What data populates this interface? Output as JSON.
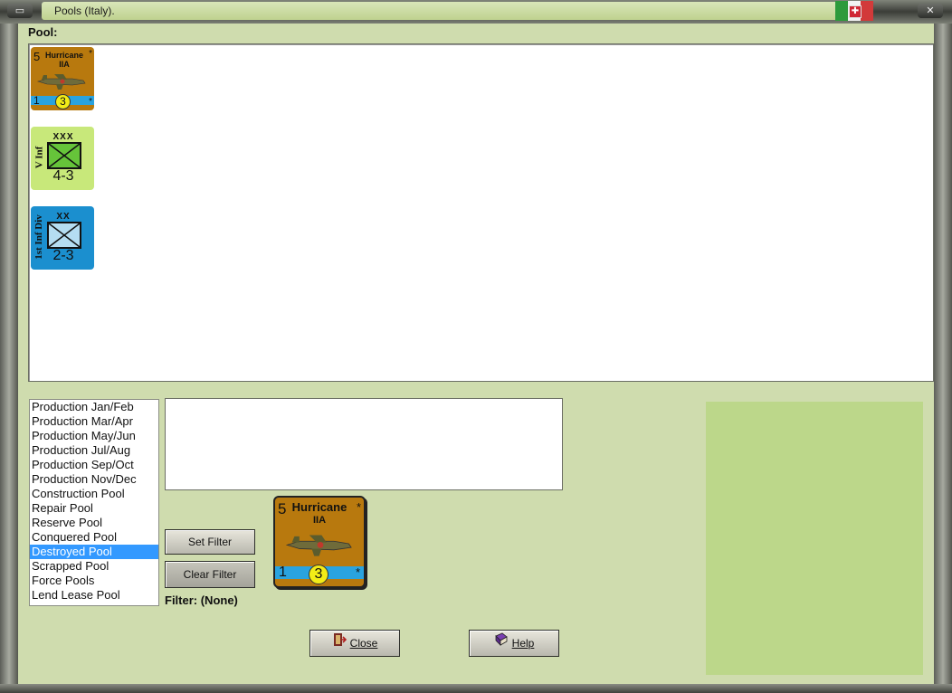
{
  "window": {
    "title": "Pools (Italy)."
  },
  "pool": {
    "label": "Pool:",
    "counters": [
      {
        "kind": "air",
        "strength": "5",
        "name_line1": "Hurricane",
        "name_line2": "IIA",
        "star": "*",
        "bottom_left": "1",
        "range": "3",
        "bottom_right": "*"
      },
      {
        "kind": "infantry",
        "side_label": "V Inf",
        "size": "XXX",
        "combat": "4-3",
        "color": "#c8e87a"
      },
      {
        "kind": "infantry",
        "side_label": "1st Inf Div",
        "size": "XX",
        "combat": "2-3",
        "color": "#1b8fcf"
      }
    ]
  },
  "pool_list": {
    "items": [
      "Production Jan/Feb",
      "Production Mar/Apr",
      "Production May/Jun",
      "Production Jul/Aug",
      "Production Sep/Oct",
      "Production Nov/Dec",
      "Construction Pool",
      "Repair Pool",
      "Reserve Pool",
      "Conquered Pool",
      "Destroyed Pool",
      "Scrapped Pool",
      "Force Pools",
      "Lend Lease Pool"
    ],
    "selected": "Destroyed Pool"
  },
  "buttons": {
    "set_filter": "Set Filter",
    "clear_filter": "Clear Filter",
    "close": "Close",
    "help": "Help"
  },
  "filter": {
    "text": "Filter: (None)"
  },
  "selected_counter": {
    "strength": "5",
    "name_line1": "Hurricane",
    "name_line2": "IIA",
    "star": "*",
    "bottom_left": "1",
    "range": "3",
    "bottom_right": "*"
  },
  "colors": {
    "background": "#cfdcae",
    "selection": "#3399ff",
    "air_counter": "#b8790e",
    "side_panel": "#bcd78a"
  }
}
